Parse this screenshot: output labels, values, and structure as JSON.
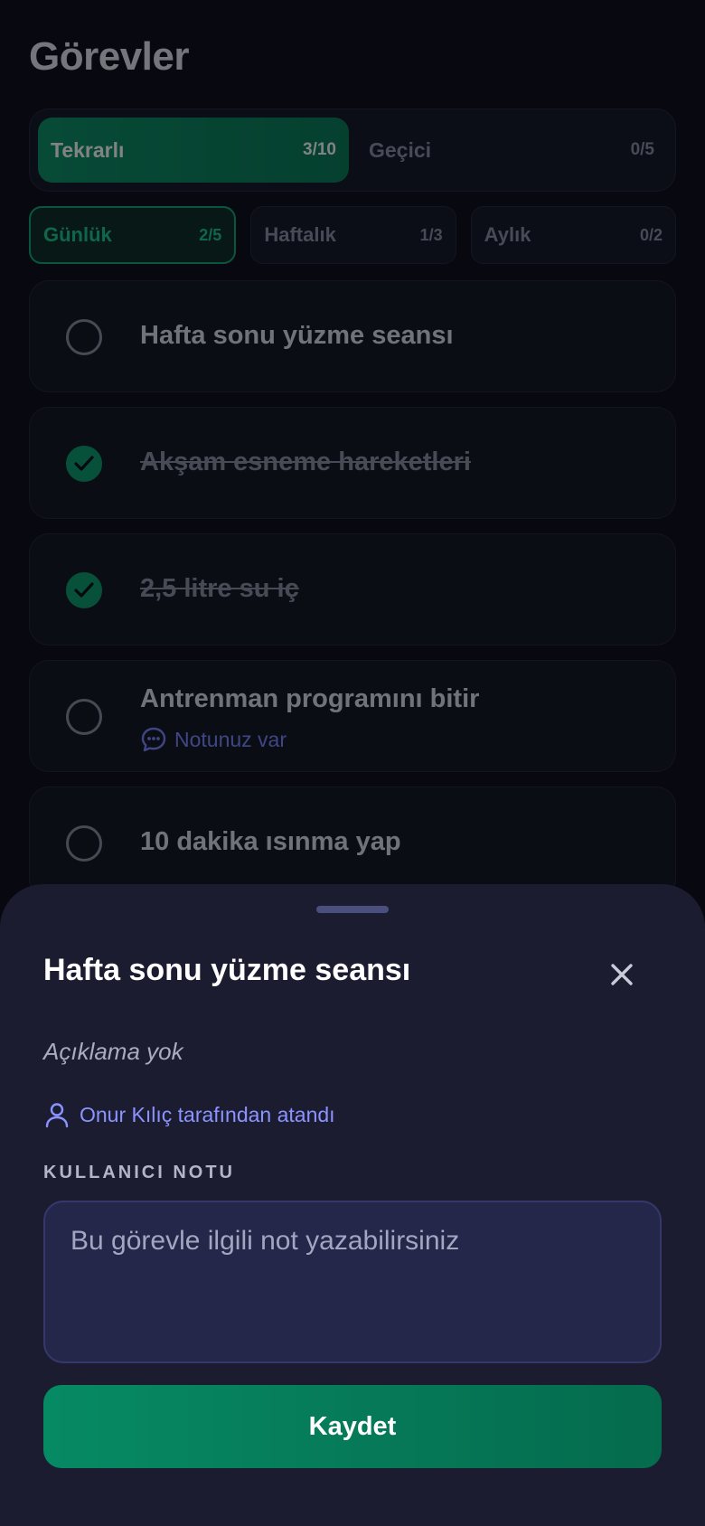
{
  "page": {
    "title": "Görevler"
  },
  "segments": [
    {
      "label": "Tekrarlı",
      "count": "3/10",
      "active": true
    },
    {
      "label": "Geçici",
      "count": "0/5",
      "active": false
    }
  ],
  "periods": [
    {
      "label": "Günlük",
      "count": "2/5",
      "active": true
    },
    {
      "label": "Haftalık",
      "count": "1/3",
      "active": false
    },
    {
      "label": "Aylık",
      "count": "0/2",
      "active": false
    }
  ],
  "tasks": [
    {
      "title": "Hafta sonu yüzme seansı",
      "done": false
    },
    {
      "title": "Akşam esneme hareketleri",
      "done": true
    },
    {
      "title": "2,5 litre su iç",
      "done": true
    },
    {
      "title": "Antrenman programını bitir",
      "done": false,
      "note": "Notunuz var"
    },
    {
      "title": "10 dakika ısınma yap",
      "done": false
    }
  ],
  "sheet": {
    "title": "Hafta sonu yüzme seansı",
    "description": "Açıklama yok",
    "assigned": "Onur Kılıç tarafından atandı",
    "note_label": "KULLANICI NOTU",
    "note_placeholder": "Bu görevle ilgili not yazabilirsiniz",
    "save_label": "Kaydet"
  },
  "colors": {
    "accent": "#0a9b68",
    "link": "#7c86ff",
    "sheet_bg": "#1b1c30"
  }
}
